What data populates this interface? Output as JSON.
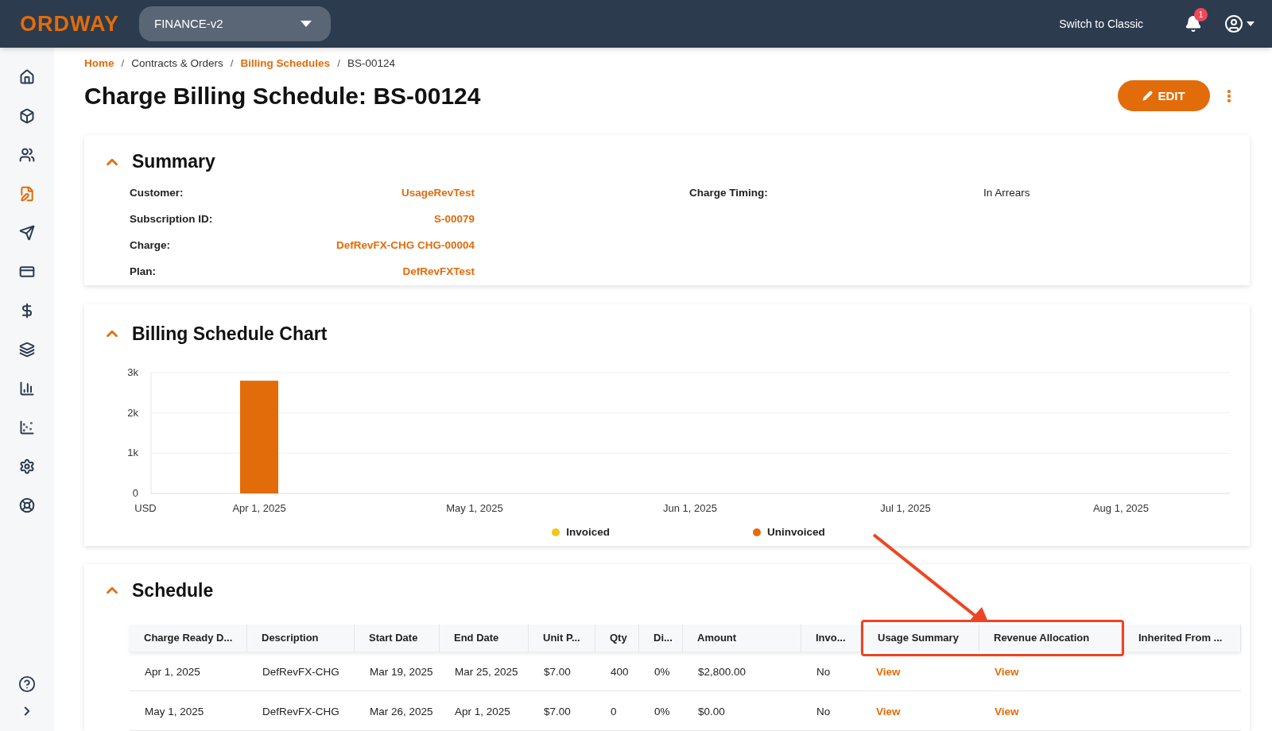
{
  "topbar": {
    "logo": "ORDWAY",
    "workspace": "FINANCE-v2",
    "switch_link": "Switch to Classic",
    "notification_count": "1"
  },
  "sidebar": {
    "items": [
      {
        "selected": false
      },
      {
        "selected": false
      },
      {
        "selected": false
      },
      {
        "selected": true
      },
      {
        "selected": false
      },
      {
        "selected": false
      },
      {
        "selected": false
      },
      {
        "selected": false
      },
      {
        "selected": false
      },
      {
        "selected": false
      },
      {
        "selected": false
      },
      {
        "selected": false
      }
    ]
  },
  "breadcrumb": {
    "separator": "/",
    "items": [
      {
        "label": "Home",
        "link": true
      },
      {
        "label": "Contracts & Orders",
        "link": false
      },
      {
        "label": "Billing Schedules",
        "link": true
      },
      {
        "label": "BS-00124",
        "link": false
      }
    ]
  },
  "page_title": "Charge Billing Schedule: BS-00124",
  "edit_button": "EDIT",
  "summary": {
    "title": "Summary",
    "expanded": true,
    "left": [
      {
        "label": "Customer:",
        "value": "UsageRevTest",
        "link": true
      },
      {
        "label": "Subscription ID:",
        "value": "S-00079",
        "link": true
      },
      {
        "label": "Charge:",
        "value": "DefRevFX-CHG CHG-00004",
        "link": true
      },
      {
        "label": "Plan:",
        "value": "DefRevFXTest",
        "link": true
      }
    ],
    "right": [
      {
        "label": "Charge Timing:",
        "value": "In Arrears",
        "link": false
      }
    ]
  },
  "chart_section": {
    "title": "Billing Schedule Chart",
    "expanded": true,
    "chart_data": {
      "type": "bar",
      "ylabel": "USD",
      "categories": [
        "Apr 1, 2025",
        "May 1, 2025",
        "Jun 1, 2025",
        "Jul 1, 2025",
        "Aug 1, 2025"
      ],
      "ylim": [
        0,
        3000
      ],
      "yticks": [
        {
          "value": 0,
          "label": "0"
        },
        {
          "value": 1000,
          "label": "1k"
        },
        {
          "value": 2000,
          "label": "2k"
        },
        {
          "value": 3000,
          "label": "3k"
        }
      ],
      "stacked": true,
      "series": [
        {
          "name": "Invoiced",
          "color": "#f5c518",
          "values": [
            null,
            null,
            null,
            null,
            null
          ]
        },
        {
          "name": "Uninvoiced",
          "color": "#e36c0a",
          "values": [
            2800,
            null,
            null,
            null,
            null
          ]
        }
      ]
    }
  },
  "schedule": {
    "title": "Schedule",
    "expanded": true,
    "columns": [
      {
        "label": "Charge Ready D...",
        "highlighted": false
      },
      {
        "label": "Description",
        "highlighted": false
      },
      {
        "label": "Start Date",
        "highlighted": false
      },
      {
        "label": "End Date",
        "highlighted": false
      },
      {
        "label": "Unit P...",
        "highlighted": false
      },
      {
        "label": "Qty",
        "highlighted": false
      },
      {
        "label": "Di...",
        "highlighted": false
      },
      {
        "label": "Amount",
        "highlighted": false
      },
      {
        "label": "Invo...",
        "highlighted": false
      },
      {
        "label": "Usage Summary",
        "highlighted": true
      },
      {
        "label": "Revenue Allocation",
        "highlighted": true
      },
      {
        "label": "Inherited From ...",
        "highlighted": false
      }
    ],
    "rows": [
      [
        "Apr 1, 2025",
        "DefRevFX-CHG",
        "Mar 19, 2025",
        "Mar 25, 2025",
        "$7.00",
        "400",
        "0%",
        "$2,800.00",
        "No",
        {
          "link": "View"
        },
        {
          "link": "View"
        },
        ""
      ],
      [
        "May 1, 2025",
        "DefRevFX-CHG",
        "Mar 26, 2025",
        "Apr 1, 2025",
        "$7.00",
        "0",
        "0%",
        "$0.00",
        "No",
        {
          "link": "View"
        },
        {
          "link": "View"
        },
        ""
      ]
    ]
  },
  "annotation": {
    "arrow": true
  }
}
